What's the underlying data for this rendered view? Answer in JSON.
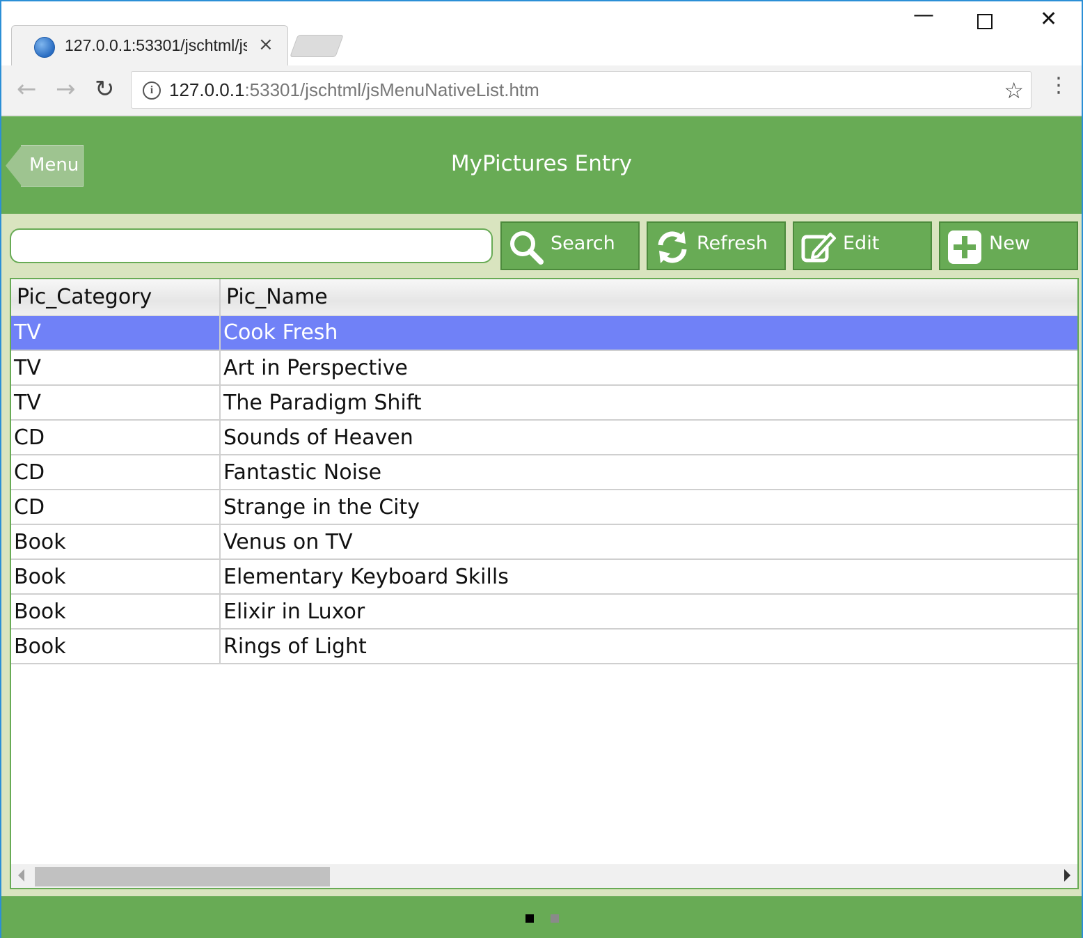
{
  "browser": {
    "tab_title": "127.0.0.1:53301/jschtml/jsMenuNativeList.htm",
    "url_host": "127.0.0.1",
    "url_rest": ":53301/jschtml/jsMenuNativeList.htm",
    "back_icon": "←",
    "forward_icon": "→",
    "reload_icon": "↻",
    "star_icon": "☆",
    "kebab_icon": "⋮",
    "close_tab_icon": "×",
    "min_icon": "—",
    "close_icon": "✕"
  },
  "header": {
    "menu_label": "Menu",
    "title": "MyPictures Entry"
  },
  "search": {
    "value": "",
    "placeholder": ""
  },
  "buttons": {
    "search": "Search",
    "refresh": "Refresh",
    "edit": "Edit",
    "new": "New"
  },
  "grid": {
    "columns": [
      "Pic_Category",
      "Pic_Name"
    ],
    "rows": [
      [
        "TV",
        "Cook Fresh"
      ],
      [
        "TV",
        "Art in Perspective"
      ],
      [
        "TV",
        "The Paradigm Shift"
      ],
      [
        "CD",
        "Sounds of Heaven"
      ],
      [
        "CD",
        "Fantastic Noise"
      ],
      [
        "CD",
        "Strange in the City"
      ],
      [
        "Book",
        "Venus on TV"
      ],
      [
        "Book",
        "Elementary Keyboard Skills"
      ],
      [
        "Book",
        "Elixir in Luxor"
      ],
      [
        "Book",
        "Rings of Light"
      ]
    ],
    "selected_row": 0
  },
  "colors": {
    "accent": "#68ab55",
    "selection": "#7081f7",
    "panel": "#d9e4bf"
  }
}
